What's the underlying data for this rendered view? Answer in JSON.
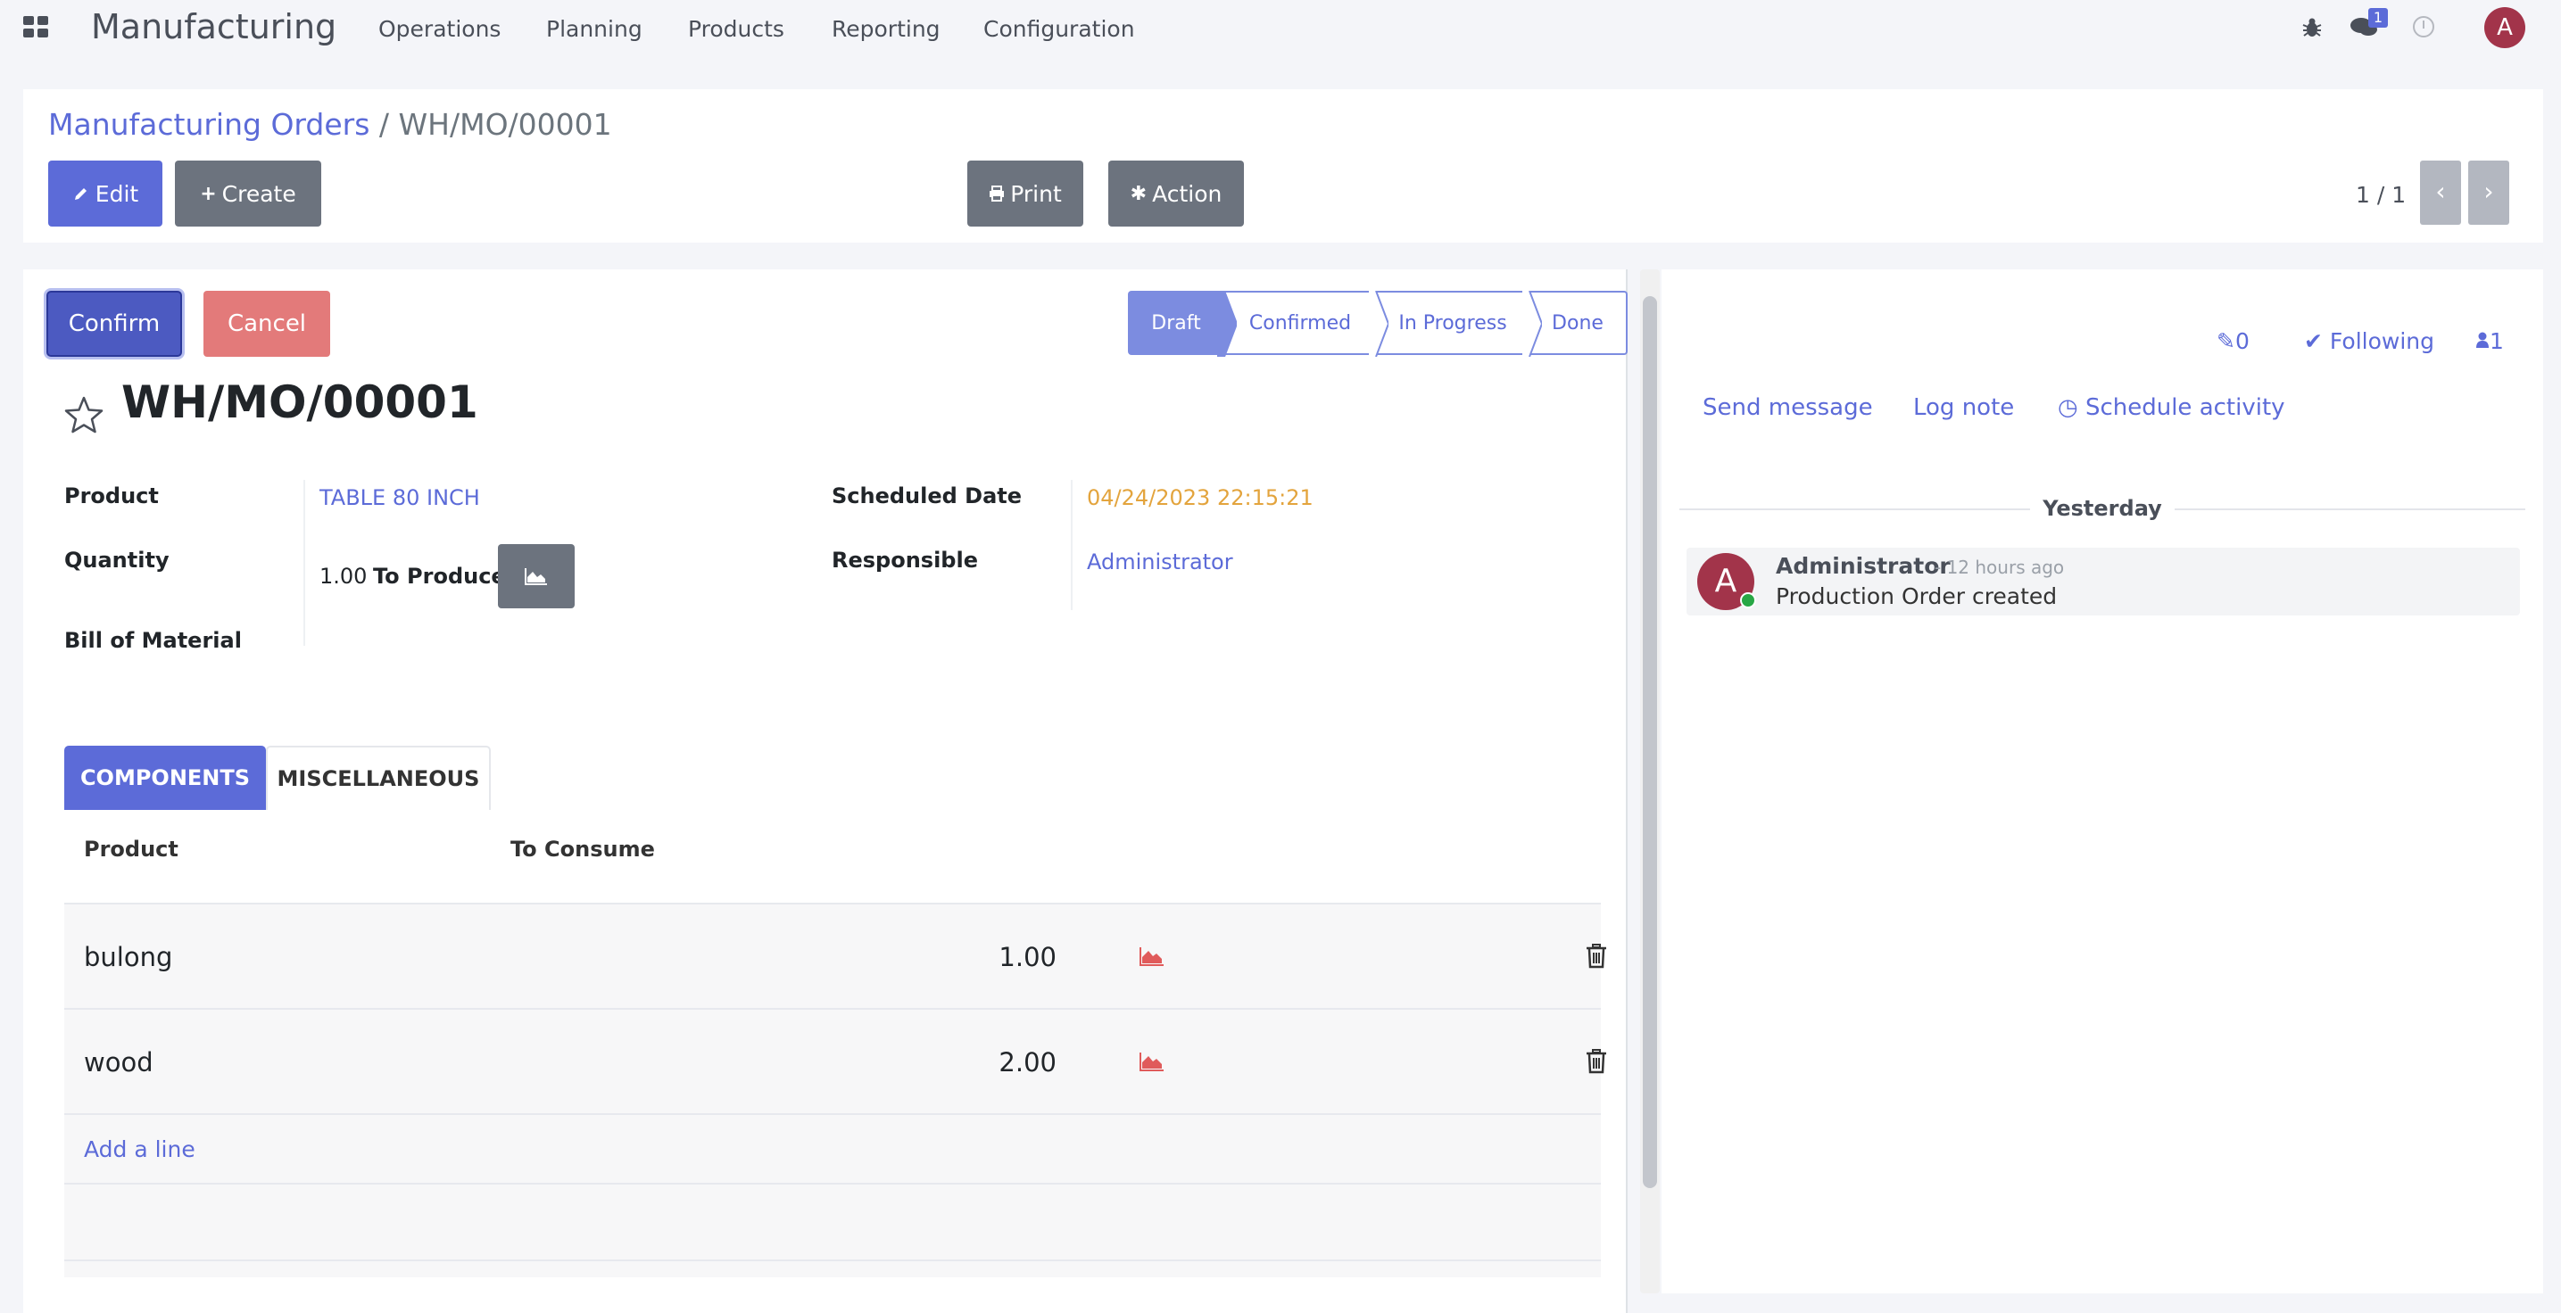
{
  "navbar": {
    "app_title": "Manufacturing",
    "menu": [
      "Operations",
      "Planning",
      "Products",
      "Reporting",
      "Configuration"
    ],
    "chat_count": "1",
    "user_initial": "A"
  },
  "control_panel": {
    "breadcrumb_parent": "Manufacturing Orders",
    "breadcrumb_separator": "/",
    "breadcrumb_current": "WH/MO/00001",
    "edit_label": "Edit",
    "create_label": "Create",
    "print_label": "Print",
    "action_label": "Action",
    "pager": "1 / 1"
  },
  "form": {
    "confirm_label": "Confirm",
    "cancel_label": "Cancel",
    "stages": [
      "Draft",
      "Confirmed",
      "In Progress",
      "Done"
    ],
    "active_stage": "Draft",
    "title": "WH/MO/00001",
    "product_label": "Product",
    "product_value": "TABLE 80 INCH",
    "quantity_label": "Quantity",
    "quantity_value": "1.00",
    "to_produce_label": "To Produce",
    "bom_label": "Bill of Material",
    "scheduled_date_label": "Scheduled Date",
    "scheduled_date_value": "04/24/2023 22:15:21",
    "responsible_label": "Responsible",
    "responsible_value": "Administrator",
    "tabs": [
      "COMPONENTS",
      "MISCELLANEOUS"
    ],
    "table": {
      "headers": [
        "Product",
        "To Consume"
      ],
      "rows": [
        {
          "product": "bulong",
          "to_consume": "1.00"
        },
        {
          "product": "wood",
          "to_consume": "2.00"
        }
      ],
      "add_line": "Add a line"
    }
  },
  "chatter": {
    "attachments": "0",
    "following": "Following",
    "followers": "1",
    "send_message": "Send message",
    "log_note": "Log note",
    "schedule_activity": "Schedule activity",
    "day_separator": "Yesterday",
    "message": {
      "author": "Administrator",
      "date": "- 12 hours ago",
      "body": "Production Order created",
      "initial": "A"
    }
  },
  "colors": {
    "primary": "#5c6bd8",
    "secondary": "#6c737e",
    "danger": "#e37a7a",
    "warning_date": "#e3a43d",
    "avatar": "#a2344a"
  }
}
